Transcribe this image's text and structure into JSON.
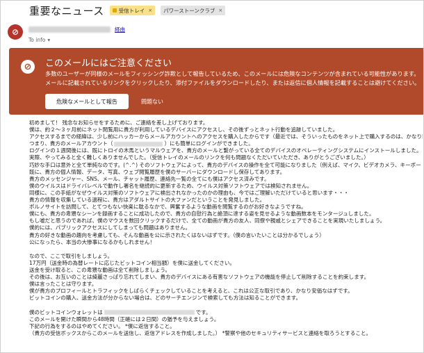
{
  "header": {
    "subject": "重要なニュース",
    "labels": [
      "受信トレイ",
      "パワーストーンクラブ"
    ],
    "label_close": "×"
  },
  "sender": {
    "avatar_glyph": "⊘",
    "unsubscribe": "経由",
    "to": "To info",
    "to_arrow": "▾"
  },
  "warning": {
    "icon": "⊘",
    "title": "このメールにはご注意ください",
    "body": "多数のユーザーが同様のメールをフィッシング詐欺として報告しているため、このメールには危険なコンテンツが含まれている可能性があります。メールに記載されているリンクをクリックしたり、添付ファイルをダウンロードしたり、または返信に個人情報を記載することは避けてください。",
    "report_button": "危険なメールとして報告",
    "ignore_button": "問題ない"
  },
  "body": {
    "p1": [
      "初めまして！ 残念なお知らせをするために、ご連絡を差し上げております。",
      "僕は、約２～３ヶ月前にネット閲覧用に貴方が利用しているデバイスにアクセスし、その後ずっとネット行動を追跡していました。",
      "アクセスするまでの経緯は、少し前にハッカーからメールアカウントへのアクセスを購入したからです（最近では、そういったものをネット上で購入するのは、かなり簡単です）。",
      "つまり、貴方のメールアカウント（",
      "ログインの１週間後には、既にトロイの木馬というマルウェアを、貴方のメールと繋がっている全てのデバイスのオペレーティングシステムにインストールしました。",
      "実際、やってみると全く難しくありませんでした。（受信トレイのメールのリンクを何も問題なくただいていただき、ありがとうございました。）",
      "巧妙な手口は意外と全て単純なのです。(^.^) そのソフトウェアによって、貴方のデバイスの操作を全て可能になりました（例えば、マイク、ビデオカメラ、キーボードの使用など）。",
      "既に、貴方の個人情報、データ、写真、ウェブ閲覧履歴を僕のサーバーにダウンロードし保存してあります。",
      "貴方のメッセンジャー、SNS、メール、チャット履歴、連絡先一覧の全てにも僕はアクセス済みです。",
      "僕のウイルスはドライバレベルで動作し署名を継続的に更新するため、ウイルス対策ソフトウェアでは検知されません。",
      "同様に、この手紙がなぜウイルス対策のソフトウェアに検出されなかったのかの理由も、今ではご理解いただけていると思います・・・",
      "貴方の情報を収集している過程に、貴方はアダルトサイトの大ファンだということを発見しました。",
      "ポルノサイトを訪問して、とてつもない快楽に耽るなかで、興奮するような動画を閲覧するのがお好きなようですね。",
      "僕にも、貴方の卑猥なシーンを録画することに成功したので、貴方の自慰行為と絶頂に達する姿を見せるような動画数本をモンタージュしました。",
      "もし嘘だと思うのであれば、僕のマウスを数回クリックするだけで、全ての動画が貴方の友人、同僚や親戚とシェアできることを実現いたしましょう。",
      "僕的には、パブリックアクセスにしてしまっても問題はありません。",
      "貴方の好きな動画の趣向を考慮しても、そんな動画を公に示されたくはないはずです。（僕の言いたいことは分かるでしょう）",
      "公になったら、本当の大惨事になるかもしれません！"
    ],
    "p1_suffix": "）にも簡単にログインができました。",
    "p2": [
      "なので、ここで取引をしましょう。",
      "17万円（送金時の為替レートに応じたビットコイン相当額）を僕に送金してください。",
      "送金を受け取ると、この卑猥な動画は全て削除しましょう。",
      "その後は、お互いのことは綺麗さっぱり忘れてしまい、貴方のデバイスにある有害なソフトウェアの機能を停止して削除することを約束します。",
      "僕は言ったことは守ります。",
      "僕が貴方のプロフィールとトラフィックをしばらくチェックしていることを考えると、これは公正な取引であり、かなり安価なはずです。",
      "ビットコインの購入、送金方法が分からない場合は、どのサーチエンジンで検索しても方法は知ることができます。"
    ],
    "p3": [
      "僕のビットコインウォレットは",
      "このメールを開けた瞬間から48時間（正確には２日間）の猶予を与えましょう。",
      "下記の行為をするのはやめてください。 *僕に返信すること。",
      "（貴方の受信ボックスからこのメールを送信し、返信アドレスを作成しました。）  *警察や他のセキュリティサービスと連絡を取ろうとすること。"
    ],
    "p3_suffix": "です。"
  }
}
